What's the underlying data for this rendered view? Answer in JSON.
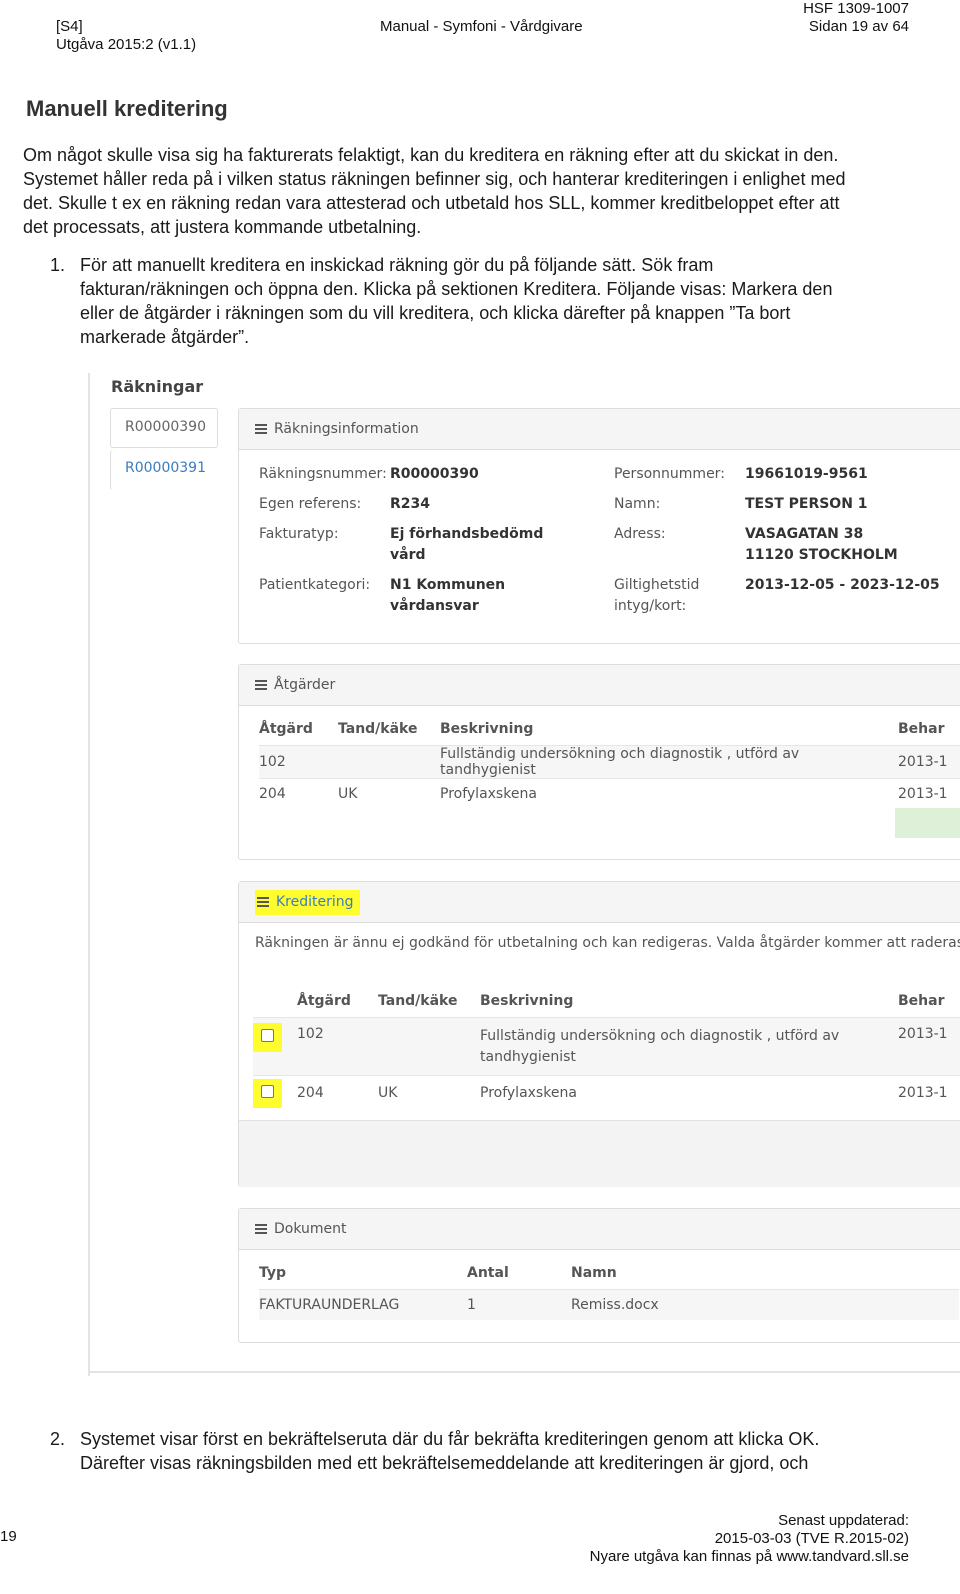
{
  "header": {
    "tag": "[S4]",
    "edition": "Utgåva 2015:2 (v1.1)",
    "manual": "Manual - Symfoni - Vårdgivare",
    "doc_id": "HSF 1309-1007",
    "page": "Sidan 19 av 64"
  },
  "section_title": "Manuell kreditering",
  "intro_lines": [
    "Om något skulle visa sig ha fakturerats felaktigt, kan du kreditera en räkning efter att du skickat in den.",
    "Systemet håller reda på i vilken status räkningen befinner sig, och hanterar krediteringen i enlighet med",
    "det. Skulle t ex en räkning redan vara attesterad och utbetald hos SLL, kommer kreditbeloppet efter att",
    "det processats, att justera kommande utbetalning."
  ],
  "step1": {
    "num": "1.",
    "lines": [
      "För att manuellt kreditera en inskickad räkning gör du på följande sätt. Sök fram",
      "fakturan/räkningen och öppna den. Klicka på sektionen Kreditera. Följande visas: Markera den",
      "eller de åtgärder i räkningen som du vill kreditera, och klicka därefter på knappen ”Ta bort",
      "markerade åtgärder”."
    ]
  },
  "screenshot": {
    "list_title": "Räkningar",
    "list_items": [
      "R00000390",
      "R00000391"
    ],
    "info_panel": {
      "title": "Räkningsinformation",
      "left": [
        {
          "label": "Räkningsnummer:",
          "value": "R00000390"
        },
        {
          "label": "Egen referens:",
          "value": "R234"
        },
        {
          "label": "Fakturatyp:",
          "value": "Ej förhandsbedömd",
          "value2": "vård"
        },
        {
          "label": "Patientkategori:",
          "value": "N1 Kommunen",
          "value2": "vårdansvar"
        }
      ],
      "right": [
        {
          "label": "Personnummer:",
          "value": "19661019-9561"
        },
        {
          "label": "Namn:",
          "value": "TEST PERSON 1"
        },
        {
          "label": "Adress:",
          "value": "VASAGATAN 38",
          "value2": "11120 STOCKHOLM"
        },
        {
          "label": "Giltighetstid",
          "label2": "intyg/kort:",
          "value": "2013-12-05 - 2023-12-05"
        }
      ]
    },
    "actions_panel": {
      "title": "Åtgärder",
      "columns": [
        "Åtgärd",
        "Tand/käke",
        "Beskrivning",
        "Behar"
      ],
      "rows": [
        [
          "102",
          "",
          "Fullständig undersökning och diagnostik , utförd av tandhygienist",
          "2013-1"
        ],
        [
          "204",
          "UK",
          "Profylaxskena",
          "2013-1"
        ]
      ]
    },
    "credit_panel": {
      "title": "Kreditering",
      "notice": "Räkningen är ännu ej godkänd för utbetalning och kan redigeras. Valda åtgärder kommer att raderas",
      "columns": [
        "Åtgärd",
        "Tand/käke",
        "Beskrivning",
        "Behar"
      ],
      "rows": [
        [
          "102",
          "",
          "Fullständig undersökning och diagnostik , utförd av",
          "2013-1"
        ],
        [
          "204",
          "UK",
          "Profylaxskena",
          "2013-1"
        ]
      ],
      "row1_desc2": "tandhygienist"
    },
    "docs_panel": {
      "title": "Dokument",
      "columns": [
        "Typ",
        "Antal",
        "Namn"
      ],
      "rows": [
        [
          "FAKTURAUNDERLAG",
          "1",
          "Remiss.docx"
        ]
      ]
    }
  },
  "step2": {
    "num": "2.",
    "lines": [
      "Systemet visar först en bekräftelseruta där du får bekräfta krediteringen genom att klicka OK.",
      "Därefter visas räkningsbilden med ett bekräftelsemeddelande att krediteringen är gjord, och"
    ]
  },
  "footer": {
    "page_num": "19",
    "updated_label": "Senast uppdaterad:",
    "updated_value": "2015-03-03 (TVE R.2015-02)",
    "newer": "Nyare utgåva kan finnas på www.tandvard.sll.se"
  },
  "colors": {
    "highlight": "#fffd2e",
    "link": "#3a7cc0",
    "green_cell": "#dff0d8"
  }
}
